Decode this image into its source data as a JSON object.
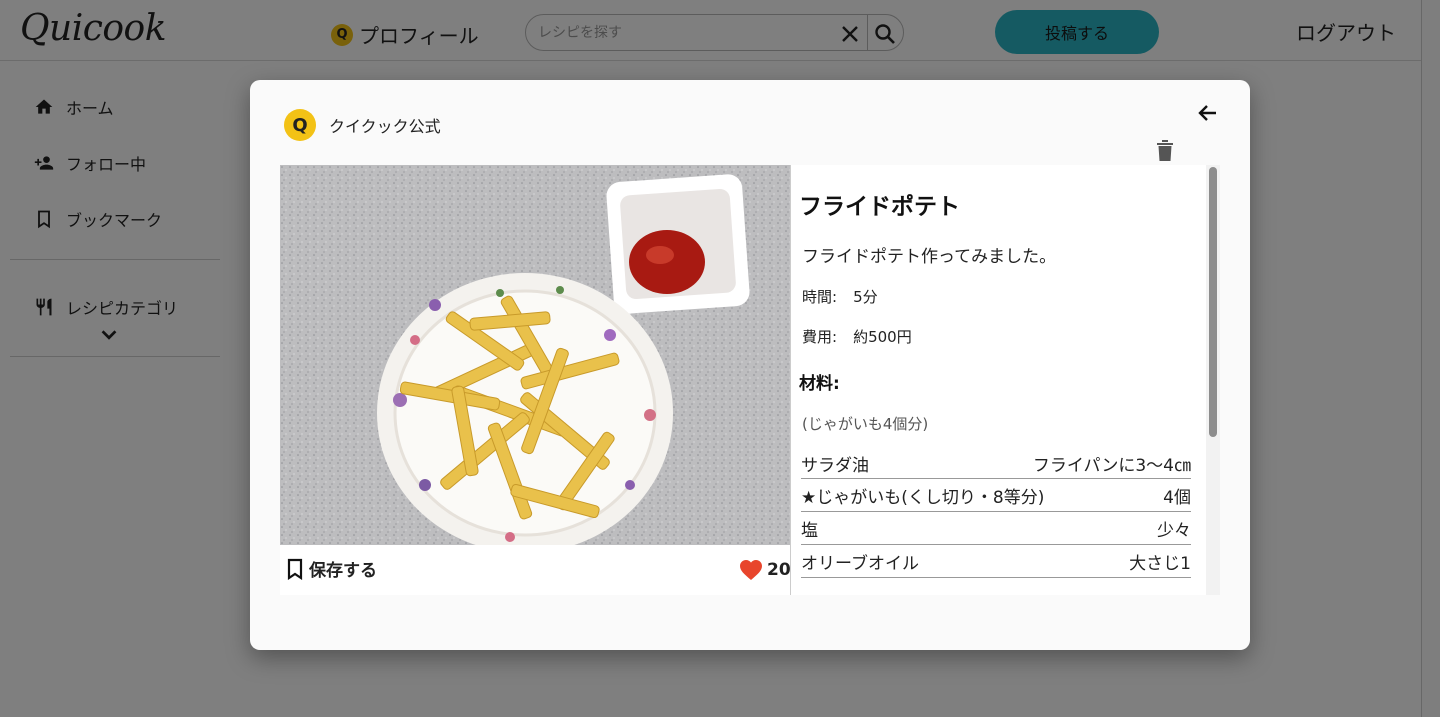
{
  "header": {
    "logo": "Quicook",
    "profile_badge": "Q",
    "profile_label": "プロフィール",
    "search_placeholder": "レシピを探す",
    "post_label": "投稿する",
    "logout_label": "ログアウト"
  },
  "sidebar": {
    "items": [
      {
        "label": "ホーム",
        "icon": "home-icon"
      },
      {
        "label": "フォロー中",
        "icon": "person-add-icon"
      },
      {
        "label": "ブックマーク",
        "icon": "bookmark-icon"
      },
      {
        "label": "レシピカテゴリ",
        "icon": "fork-knife-icon"
      }
    ]
  },
  "modal": {
    "author_badge": "Q",
    "author_name": "クイクック公式",
    "photo_icon": "french-fries-photo",
    "save_label": "保存する",
    "like_count": "20",
    "recipe": {
      "title": "フライドポテト",
      "description": "フライドポテト作ってみました。",
      "time_label": "時間:",
      "time_value": "5分",
      "cost_label": "費用:",
      "cost_value": "約500円",
      "ingredients_heading": "材料:",
      "serving": "(じゃがいも4個分)",
      "ingredients": [
        {
          "name": "サラダ油",
          "amount": "フライパンに3〜4㎝"
        },
        {
          "name": "★じゃがいも(くし切り・8等分)",
          "amount": "4個"
        },
        {
          "name": "塩",
          "amount": "少々"
        },
        {
          "name": "オリーブオイル",
          "amount": "大さじ1"
        }
      ]
    }
  },
  "colors": {
    "accent": "#2ab5c4",
    "badge": "#f3c216",
    "heart": "#e8452c"
  }
}
